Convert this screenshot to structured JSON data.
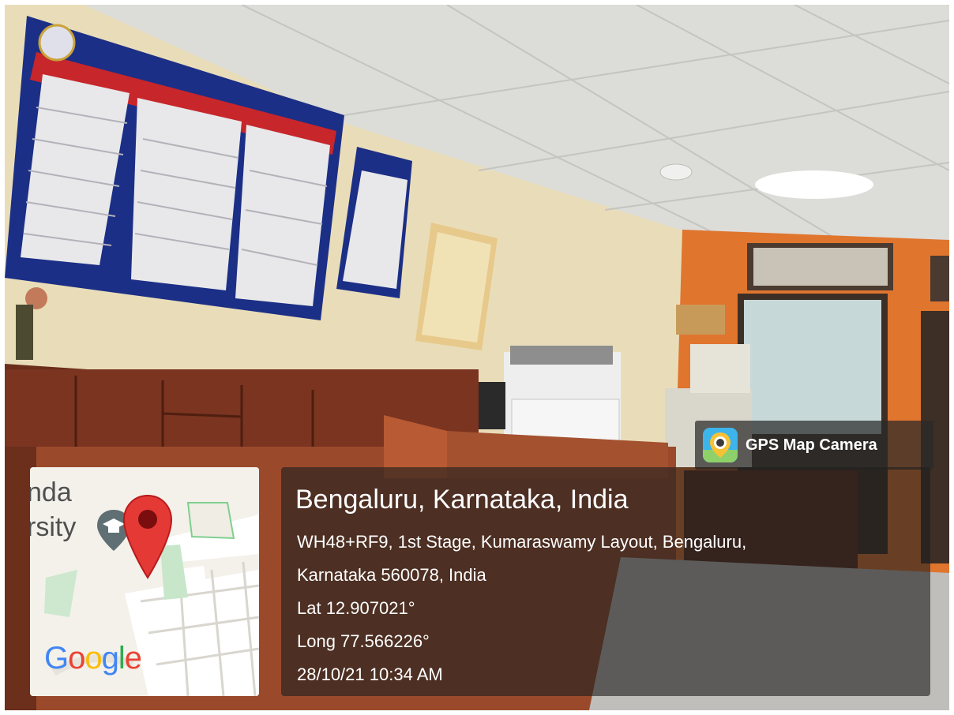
{
  "badge": {
    "label": "GPS Map Camera",
    "icon": "map-camera-icon"
  },
  "map": {
    "place_line_1": "nda",
    "place_line_2": "rsity",
    "provider": "Google",
    "pin_color": "#e53935",
    "marker_icon": "location-pin-icon",
    "poi_icon": "graduation-cap-icon"
  },
  "location": {
    "title": "Bengaluru, Karnataka, India",
    "address_line_1": "WH48+RF9, 1st Stage, Kumaraswamy Layout, Bengaluru,",
    "address_line_2": "Karnataka 560078, India",
    "latitude": "Lat 12.907021°",
    "longitude": "Long 77.566226°",
    "datetime": "28/10/21 10:34 AM"
  }
}
